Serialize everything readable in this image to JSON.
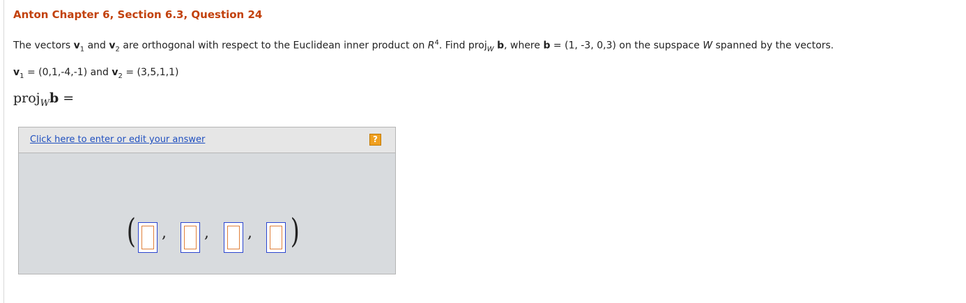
{
  "title": "Anton Chapter 6, Section 6.3, Question 24",
  "question": {
    "t1": "The vectors ",
    "v1": "v",
    "v1_sub": "1",
    "and": " and ",
    "v2": "v",
    "v2_sub": "2",
    "t2": " are orthogonal with respect to the Euclidean inner product on ",
    "R": "R",
    "R_sup": "4",
    "t3": ". Find proj",
    "W_sub": "W",
    "b": "b",
    "t4": ", where ",
    "b2": "b",
    "t5": " = (1, -3, 0,3) on the supspace ",
    "W": "W",
    "t6": " spanned by the vectors."
  },
  "vectors": {
    "v1": "v",
    "v1_sub": "1",
    "v1_val": " = (0,1,-4,-1) and ",
    "v2": "v",
    "v2_sub": "2",
    "v2_val": " = (3,5,1,1)"
  },
  "proj_label": {
    "proj": "proj",
    "W_sub": "W",
    "b": "b",
    "eq": " ="
  },
  "answer": {
    "link_text": "Click here to enter or edit your answer",
    "help_text": "?",
    "open_paren": "(",
    "close_paren": ")",
    "comma": ","
  },
  "icons": {
    "help": "question-mark-icon"
  },
  "colors": {
    "title": "#c2410c",
    "link": "#1f4fbf",
    "help": "#f0a020",
    "slot_border": "#2a44d0",
    "slot_inner": "#e0803a"
  }
}
